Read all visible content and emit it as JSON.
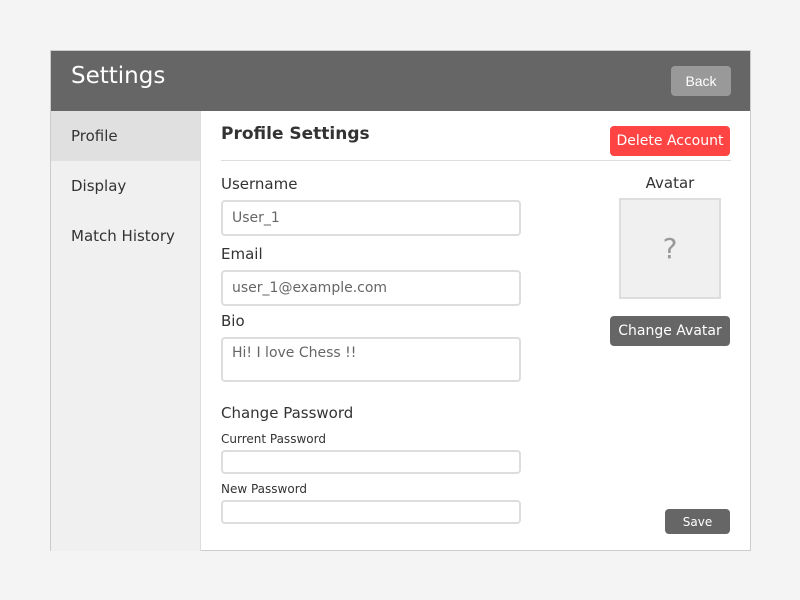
{
  "header": {
    "title": "Settings",
    "back_label": "Back"
  },
  "sidebar": {
    "items": [
      {
        "label": "Profile",
        "active": true
      },
      {
        "label": "Display"
      },
      {
        "label": "Match History"
      }
    ]
  },
  "main": {
    "title": "Profile Settings",
    "delete_label": "Delete Account",
    "username": {
      "label": "Username",
      "value": "User_1"
    },
    "email": {
      "label": "Email",
      "value": "user_1@example.com"
    },
    "bio": {
      "label": "Bio",
      "value": "Hi! I love Chess !!"
    },
    "password": {
      "heading": "Change Password",
      "current_label": "Current Password",
      "current_value": "",
      "new_label": "New Password",
      "new_value": ""
    },
    "avatar": {
      "label": "Avatar",
      "placeholder": "?",
      "change_label": "Change Avatar"
    },
    "save_label": "Save"
  },
  "colors": {
    "header": "#666666",
    "danger": "#ff4444",
    "button": "#666666",
    "back": "#999999"
  }
}
